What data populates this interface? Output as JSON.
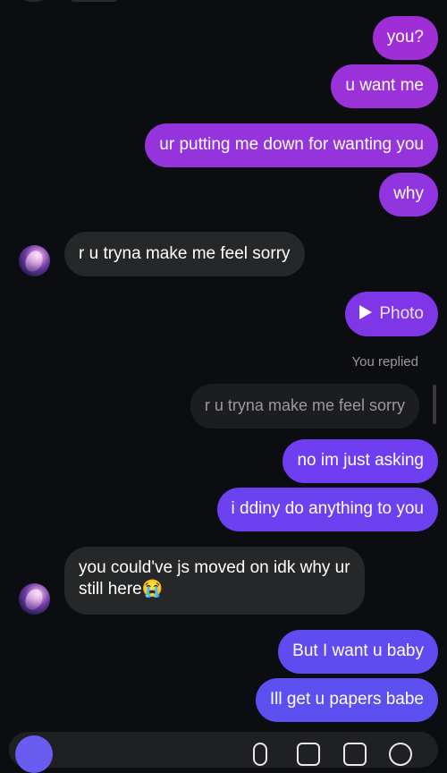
{
  "messages": {
    "m1": "you?",
    "m2": "u want me",
    "m3": "ur putting me down for wanting you",
    "m4": "why",
    "m5": "r u tryna make me feel sorry",
    "m6": "Photo",
    "replied_label": "You replied",
    "quoted": "r u tryna make me feel sorry",
    "m7": "no im just asking",
    "m8": "i ddiny do anything to you",
    "m9_line1": "you could've js moved on idk why ur",
    "m9_line2": "still here😭",
    "m10": "But I want u baby",
    "m11": "Ill get u papers babe"
  },
  "colors": {
    "sent_top": "#9b2fd8",
    "sent_mid": "#7c3df0",
    "sent_bottom": "#5e4cf0",
    "received": "#262729",
    "background": "#0c0d10"
  },
  "icons": {
    "photo": "play-triangle-icon",
    "composer": [
      "camera-icon",
      "mic-icon",
      "gallery-icon",
      "sticker-icon",
      "plus-icon"
    ]
  }
}
